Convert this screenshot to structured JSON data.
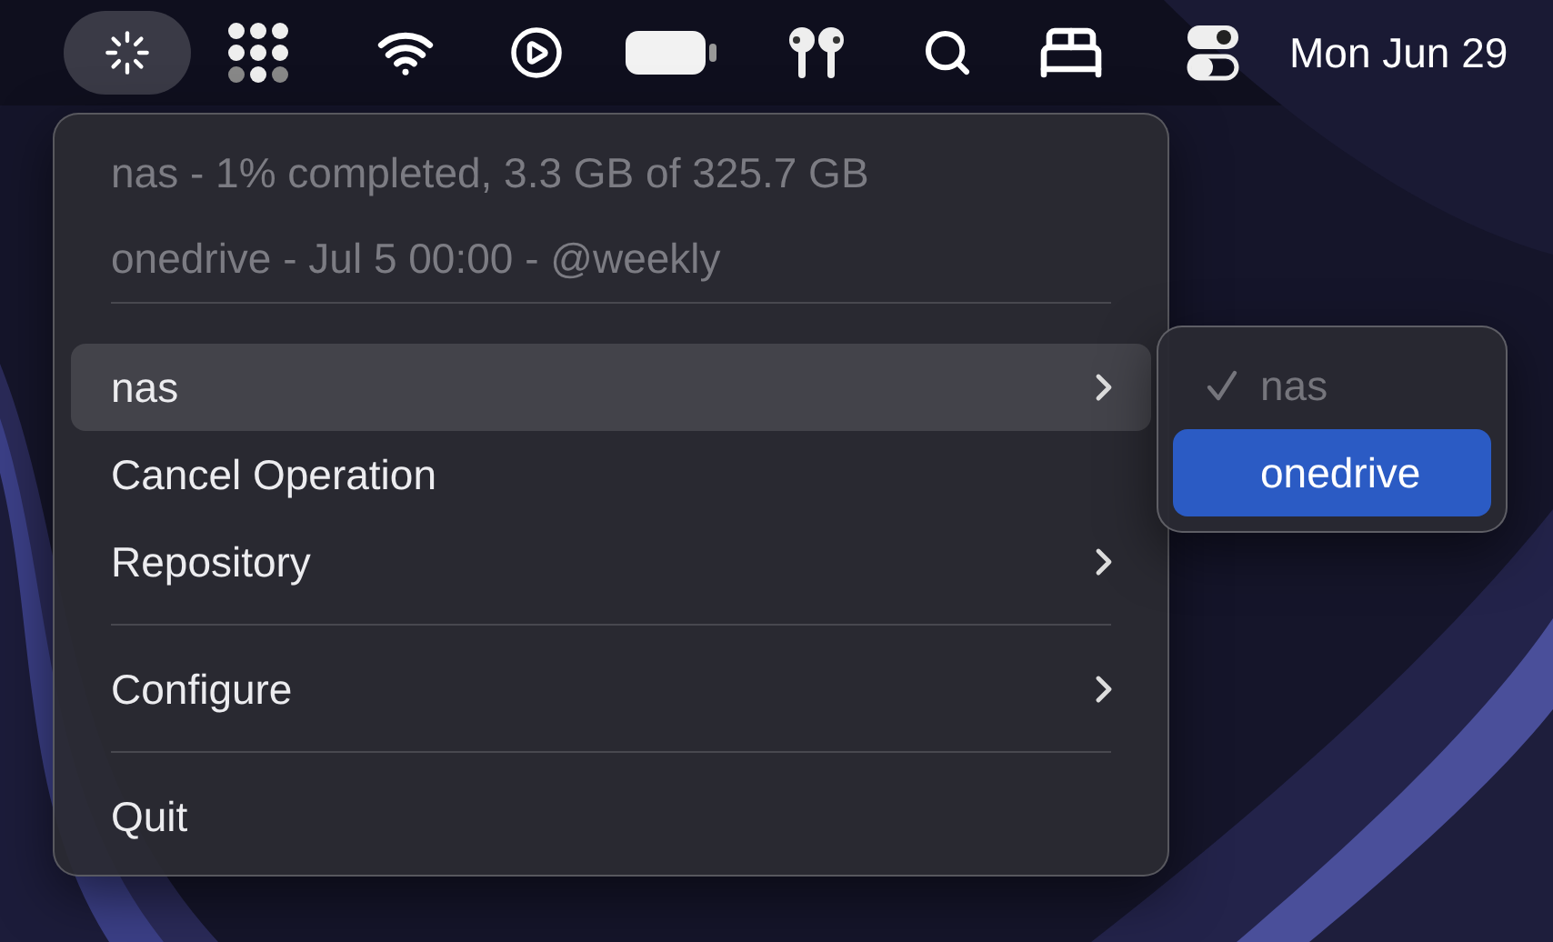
{
  "menu_bar": {
    "items": [
      {
        "kind": "spinner",
        "selected": true
      },
      {
        "kind": "dots",
        "selected": false
      },
      {
        "kind": "wifi",
        "selected": false
      },
      {
        "kind": "play",
        "selected": false
      },
      {
        "kind": "battery",
        "selected": false
      },
      {
        "kind": "earbuds",
        "selected": false
      },
      {
        "kind": "search",
        "selected": false
      },
      {
        "kind": "bed",
        "selected": false
      },
      {
        "kind": "toggles",
        "selected": false
      }
    ],
    "clock": "Mon Jun 29"
  },
  "menu": {
    "status_lines": [
      "nas - 1% completed, 3.3 GB of 325.7 GB",
      "onedrive - Jul 5 00:00 - @weekly"
    ],
    "groups": [
      [
        {
          "label": "nas",
          "submenu": true,
          "selected": true
        },
        {
          "label": "Cancel Operation",
          "submenu": false,
          "selected": false
        },
        {
          "label": "Repository",
          "submenu": true,
          "selected": false
        }
      ],
      [
        {
          "label": "Configure",
          "submenu": true,
          "selected": false
        }
      ],
      [
        {
          "label": "Quit",
          "submenu": false,
          "selected": false
        }
      ]
    ]
  },
  "submenu": {
    "items": [
      {
        "label": "nas",
        "checked": true,
        "disabled": true,
        "selected": false
      },
      {
        "label": "onedrive",
        "checked": false,
        "disabled": false,
        "selected": true
      }
    ]
  }
}
